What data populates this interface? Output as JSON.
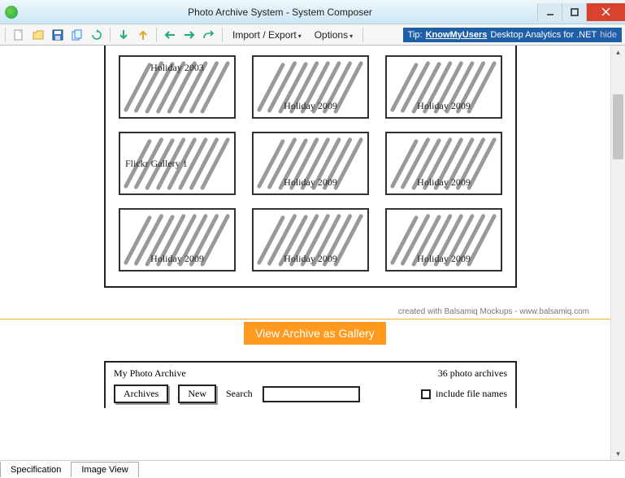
{
  "window": {
    "title": "Photo Archive System - System Composer"
  },
  "toolbar": {
    "import_export": "Import / Export",
    "options": "Options"
  },
  "tip": {
    "prefix": "Tip:",
    "link": "KnowMyUsers",
    "rest": "Desktop Analytics for .NET",
    "hide": "hide"
  },
  "thumbs": [
    {
      "label": "Holiday 2003",
      "row": 1
    },
    {
      "label": "Holiday 2009",
      "row": 2
    },
    {
      "label": "Holiday 2009",
      "row": 2
    },
    {
      "label": "Flickr Gallery 1",
      "row": 2,
      "flickr": true
    },
    {
      "label": "Holiday 2009",
      "row": 2
    },
    {
      "label": "Holiday 2009",
      "row": 2
    },
    {
      "label": "Holiday 2009",
      "row": 3
    },
    {
      "label": "Holiday 2009",
      "row": 3
    },
    {
      "label": "Holiday 2009",
      "row": 3
    }
  ],
  "credit": "created with Balsamiq Mockups - www.balsamiq.com",
  "orange_btn": "View Archive as Gallery",
  "lower": {
    "title": "My Photo Archive",
    "count": "36 photo archives",
    "archives_btn": "Archives",
    "new_btn": "New",
    "search_label": "Search",
    "include": "include file names"
  },
  "tabs": {
    "spec": "Specification",
    "image": "Image View"
  }
}
